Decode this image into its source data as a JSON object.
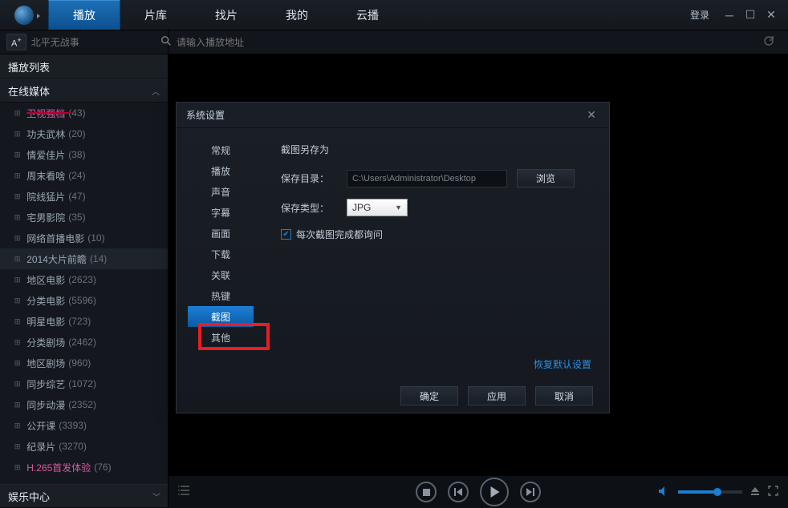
{
  "tabs": {
    "play": "播放",
    "lib": "片库",
    "find": "找片",
    "mine": "我的",
    "cloud": "云播"
  },
  "login": "登录",
  "search_placeholder": "北平无战事",
  "url_placeholder": "请输入播放地址",
  "sidebar": {
    "playlist_header": "播放列表",
    "online_header": "在线媒体",
    "items": [
      {
        "name": "卫视强档",
        "count": "(43)",
        "pink": true,
        "strike": true
      },
      {
        "name": "功夫武林",
        "count": "(20)"
      },
      {
        "name": "情爱佳片",
        "count": "(38)"
      },
      {
        "name": "周末看啥",
        "count": "(24)"
      },
      {
        "name": "院线猛片",
        "count": "(47)"
      },
      {
        "name": "宅男影院",
        "count": "(35)"
      },
      {
        "name": "网络首播电影",
        "count": "(10)"
      },
      {
        "name": "2014大片前瞻",
        "count": "(14)",
        "sel": true
      },
      {
        "name": "地区电影",
        "count": "(2623)"
      },
      {
        "name": "分类电影",
        "count": "(5596)"
      },
      {
        "name": "明星电影",
        "count": "(723)"
      },
      {
        "name": "分类剧场",
        "count": "(2462)"
      },
      {
        "name": "地区剧场",
        "count": "(960)"
      },
      {
        "name": "同步综艺",
        "count": "(1072)"
      },
      {
        "name": "同步动漫",
        "count": "(2352)"
      },
      {
        "name": "公开课",
        "count": "(3393)"
      },
      {
        "name": "纪录片",
        "count": "(3270)"
      },
      {
        "name": "H.265首发体验",
        "count": "(76)",
        "pink": true
      }
    ],
    "entertainment_header": "娱乐中心"
  },
  "dialog": {
    "title": "系统设置",
    "nav": [
      "常规",
      "播放",
      "声音",
      "字幕",
      "画面",
      "下载",
      "关联",
      "热键",
      "截图",
      "其他"
    ],
    "active_nav": "截图",
    "section_title": "截图另存为",
    "save_dir_label": "保存目录：",
    "save_dir_value": "C:\\Users\\Administrator\\Desktop",
    "browse": "浏览",
    "save_type_label": "保存类型：",
    "save_type_value": "JPG",
    "ask_each": "每次截图完成都询问",
    "restore": "恢复默认设置",
    "ok": "确定",
    "apply": "应用",
    "cancel": "取消"
  }
}
